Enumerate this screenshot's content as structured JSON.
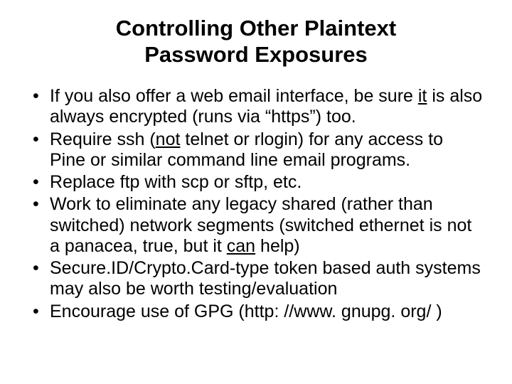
{
  "title_line1": "Controlling Other Plaintext",
  "title_line2": "Password Exposures",
  "bullets": {
    "b0_a": "If you also offer a web email interface, be sure ",
    "b0_u1": "it",
    "b0_b": " is also always encrypted (runs via “https”) too.",
    "b1_a": "Require ssh (",
    "b1_u1": "not",
    "b1_b": " telnet or rlogin) for any access to Pine or similar command line email programs.",
    "b2": "Replace ftp with scp or sftp, etc.",
    "b3_a": "Work to eliminate any legacy shared (rather than switched) network segments (switched ethernet is not a panacea, true, but it ",
    "b3_u1": "can",
    "b3_b": " help)",
    "b4": "Secure.ID/Crypto.Card-type token based auth systems may also be worth testing/evaluation",
    "b5": "Encourage use of GPG (http: //www. gnupg. org/ )"
  }
}
